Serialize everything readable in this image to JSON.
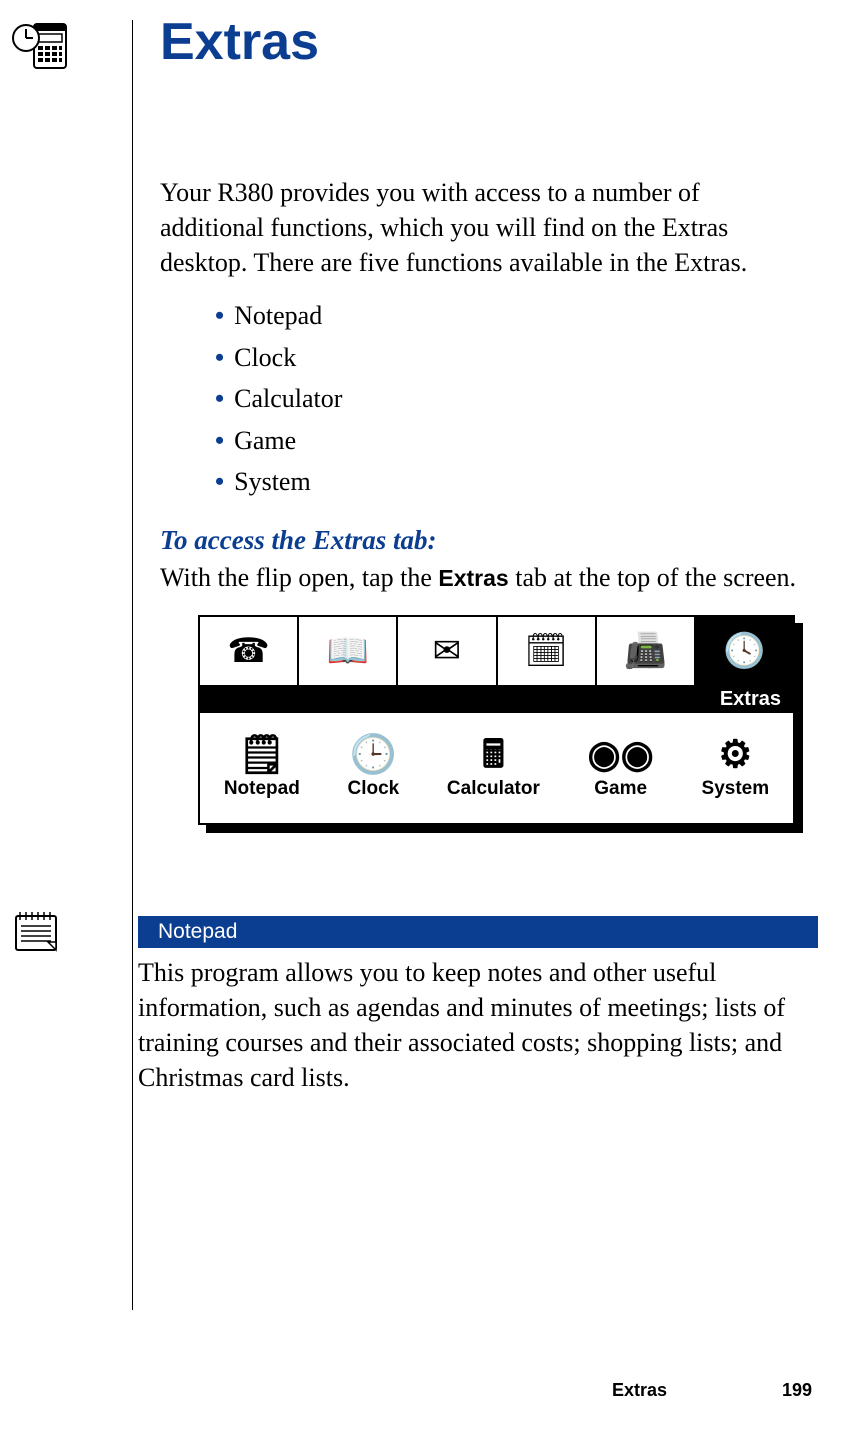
{
  "title": "Extras",
  "intro": "Your R380 provides you with access to a number of additional functions, which you will find on the Extras desktop. There are five functions available in the Extras.",
  "bullets": [
    "Notepad",
    "Clock",
    "Calculator",
    "Game",
    "System"
  ],
  "subhead": "To access the Extras tab:",
  "access_pre": "With the flip open, tap the ",
  "access_bold": "Extras",
  "access_post": " tab at the top of the screen.",
  "device": {
    "tab_label": "Extras",
    "apps": [
      {
        "label": "Notepad",
        "glyph": "🗒"
      },
      {
        "label": "Clock",
        "glyph": "🕒"
      },
      {
        "label": "Calculator",
        "glyph": "🖩"
      },
      {
        "label": "Game",
        "glyph": "◉◉"
      },
      {
        "label": "System",
        "glyph": "⚙"
      }
    ],
    "top_tabs": [
      "☎",
      "📖",
      "✉",
      "🗓",
      "📠",
      "🕓"
    ]
  },
  "section": {
    "heading": "Notepad",
    "body": "This program allows you to keep notes and other useful information, such as agendas and minutes of meetings; lists of training courses and their associated costs; shopping lists; and Christmas card lists."
  },
  "footer": {
    "title": "Extras",
    "page": "199"
  }
}
